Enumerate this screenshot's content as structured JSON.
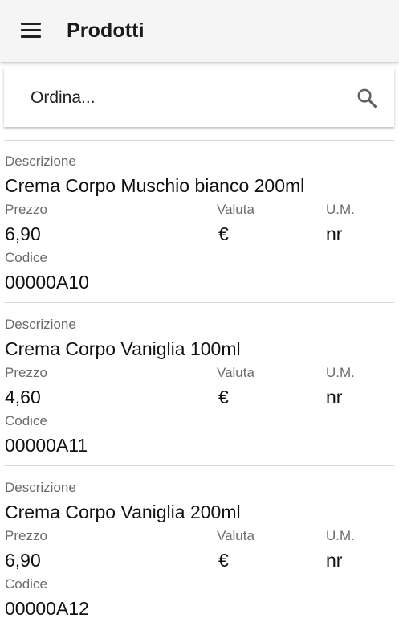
{
  "appbar": {
    "title": "Prodotti",
    "menu_icon": "hamburger-menu-icon"
  },
  "search": {
    "placeholder": "Ordina...",
    "value": "",
    "icon": "search-icon"
  },
  "labels": {
    "description": "Descrizione",
    "price": "Prezzo",
    "currency": "Valuta",
    "unit": "U.M.",
    "code": "Codice"
  },
  "products": [
    {
      "description": "Crema Corpo Muschio bianco 200ml",
      "price": "6,90",
      "currency": "€",
      "unit": "nr",
      "code": "00000A10"
    },
    {
      "description": "Crema Corpo Vaniglia 100ml",
      "price": "4,60",
      "currency": "€",
      "unit": "nr",
      "code": "00000A11"
    },
    {
      "description": "Crema Corpo Vaniglia 200ml",
      "price": "6,90",
      "currency": "€",
      "unit": "nr",
      "code": "00000A12"
    }
  ]
}
